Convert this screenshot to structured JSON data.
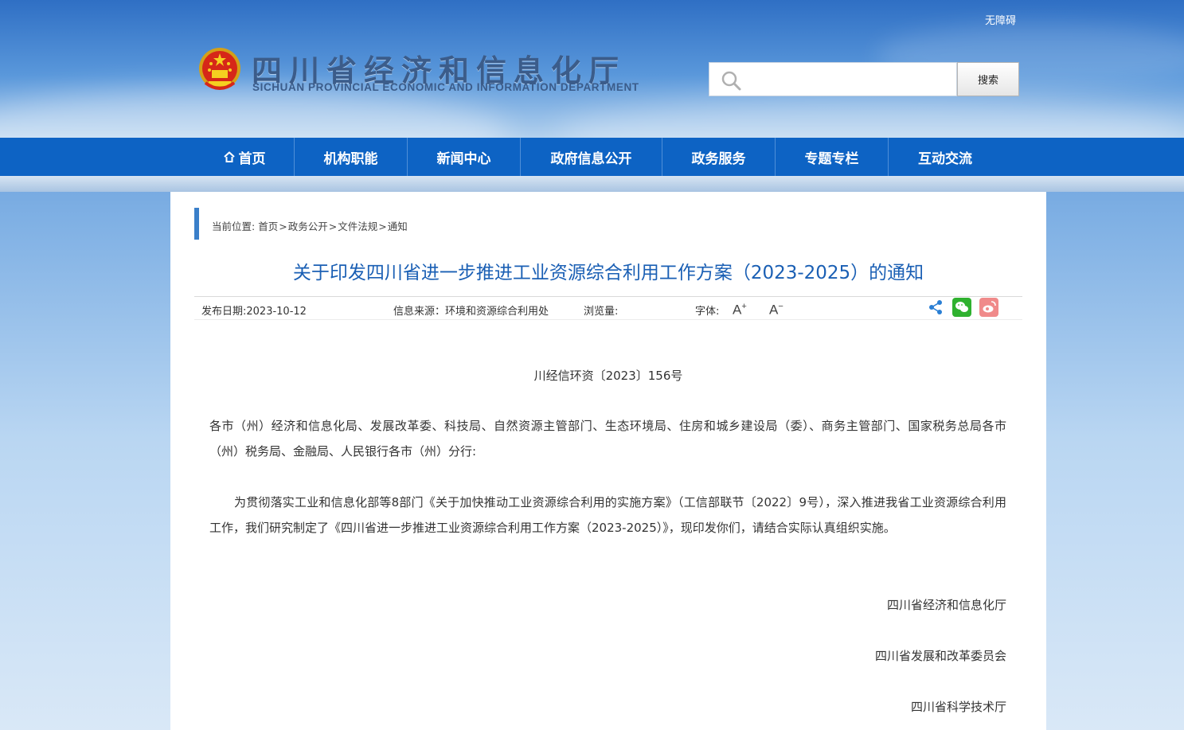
{
  "header": {
    "accessibility_label": "无障碍",
    "site_title": "四川省经济和信息化厅",
    "site_subtitle": "SICHUAN PROVINCIAL ECONOMIC AND INFORMATION DEPARTMENT",
    "search": {
      "placeholder": "",
      "button_label": "搜索"
    }
  },
  "nav": {
    "items": [
      {
        "label": "首页",
        "icon": "home-icon"
      },
      {
        "label": "机构职能"
      },
      {
        "label": "新闻中心"
      },
      {
        "label": "政府信息公开"
      },
      {
        "label": "政务服务"
      },
      {
        "label": "专题专栏"
      },
      {
        "label": "互动交流"
      }
    ]
  },
  "breadcrumb": {
    "prefix": "当前位置: ",
    "items": [
      "首页",
      "政务公开",
      "文件法规",
      "通知"
    ],
    "separator": ">"
  },
  "article": {
    "title": "关于印发四川省进一步推进工业资源综合利用工作方案（2023-2025）的通知",
    "meta": {
      "publish_date": "发布日期:2023-10-12",
      "source": "信息来源：环境和资源综合利用处",
      "views": "浏览量:",
      "font_label": "字体:",
      "font_increase": "A",
      "font_decrease": "A"
    },
    "share_icons": [
      "share-icon",
      "wechat-icon",
      "weibo-icon"
    ],
    "doc_number": "川经信环资〔2023〕156号",
    "recipients": "各市（州）经济和信息化局、发展改革委、科技局、自然资源主管部门、生态环境局、住房和城乡建设局（委）、商务主管部门、国家税务总局各市（州）税务局、金融局、人民银行各市（州）分行:",
    "body": "为贯彻落实工业和信息化部等8部门《关于加快推动工业资源综合利用的实施方案》（工信部联节〔2022〕9号），深入推进我省工业资源综合利用工作，我们研究制定了《四川省进一步推进工业资源综合利用工作方案（2023-2025）》，现印发你们，请结合实际认真组织实施。",
    "signatures": [
      "四川省经济和信息化厅",
      "四川省发展和改革委员会",
      "四川省科学技术厅"
    ]
  },
  "colors": {
    "nav_bg": "#0d63c4",
    "title_blue": "#1a5fb4",
    "crumb_bar": "#3a7fc9",
    "wechat_green": "#2fb12f",
    "weibo_pink": "#f08a8a"
  }
}
